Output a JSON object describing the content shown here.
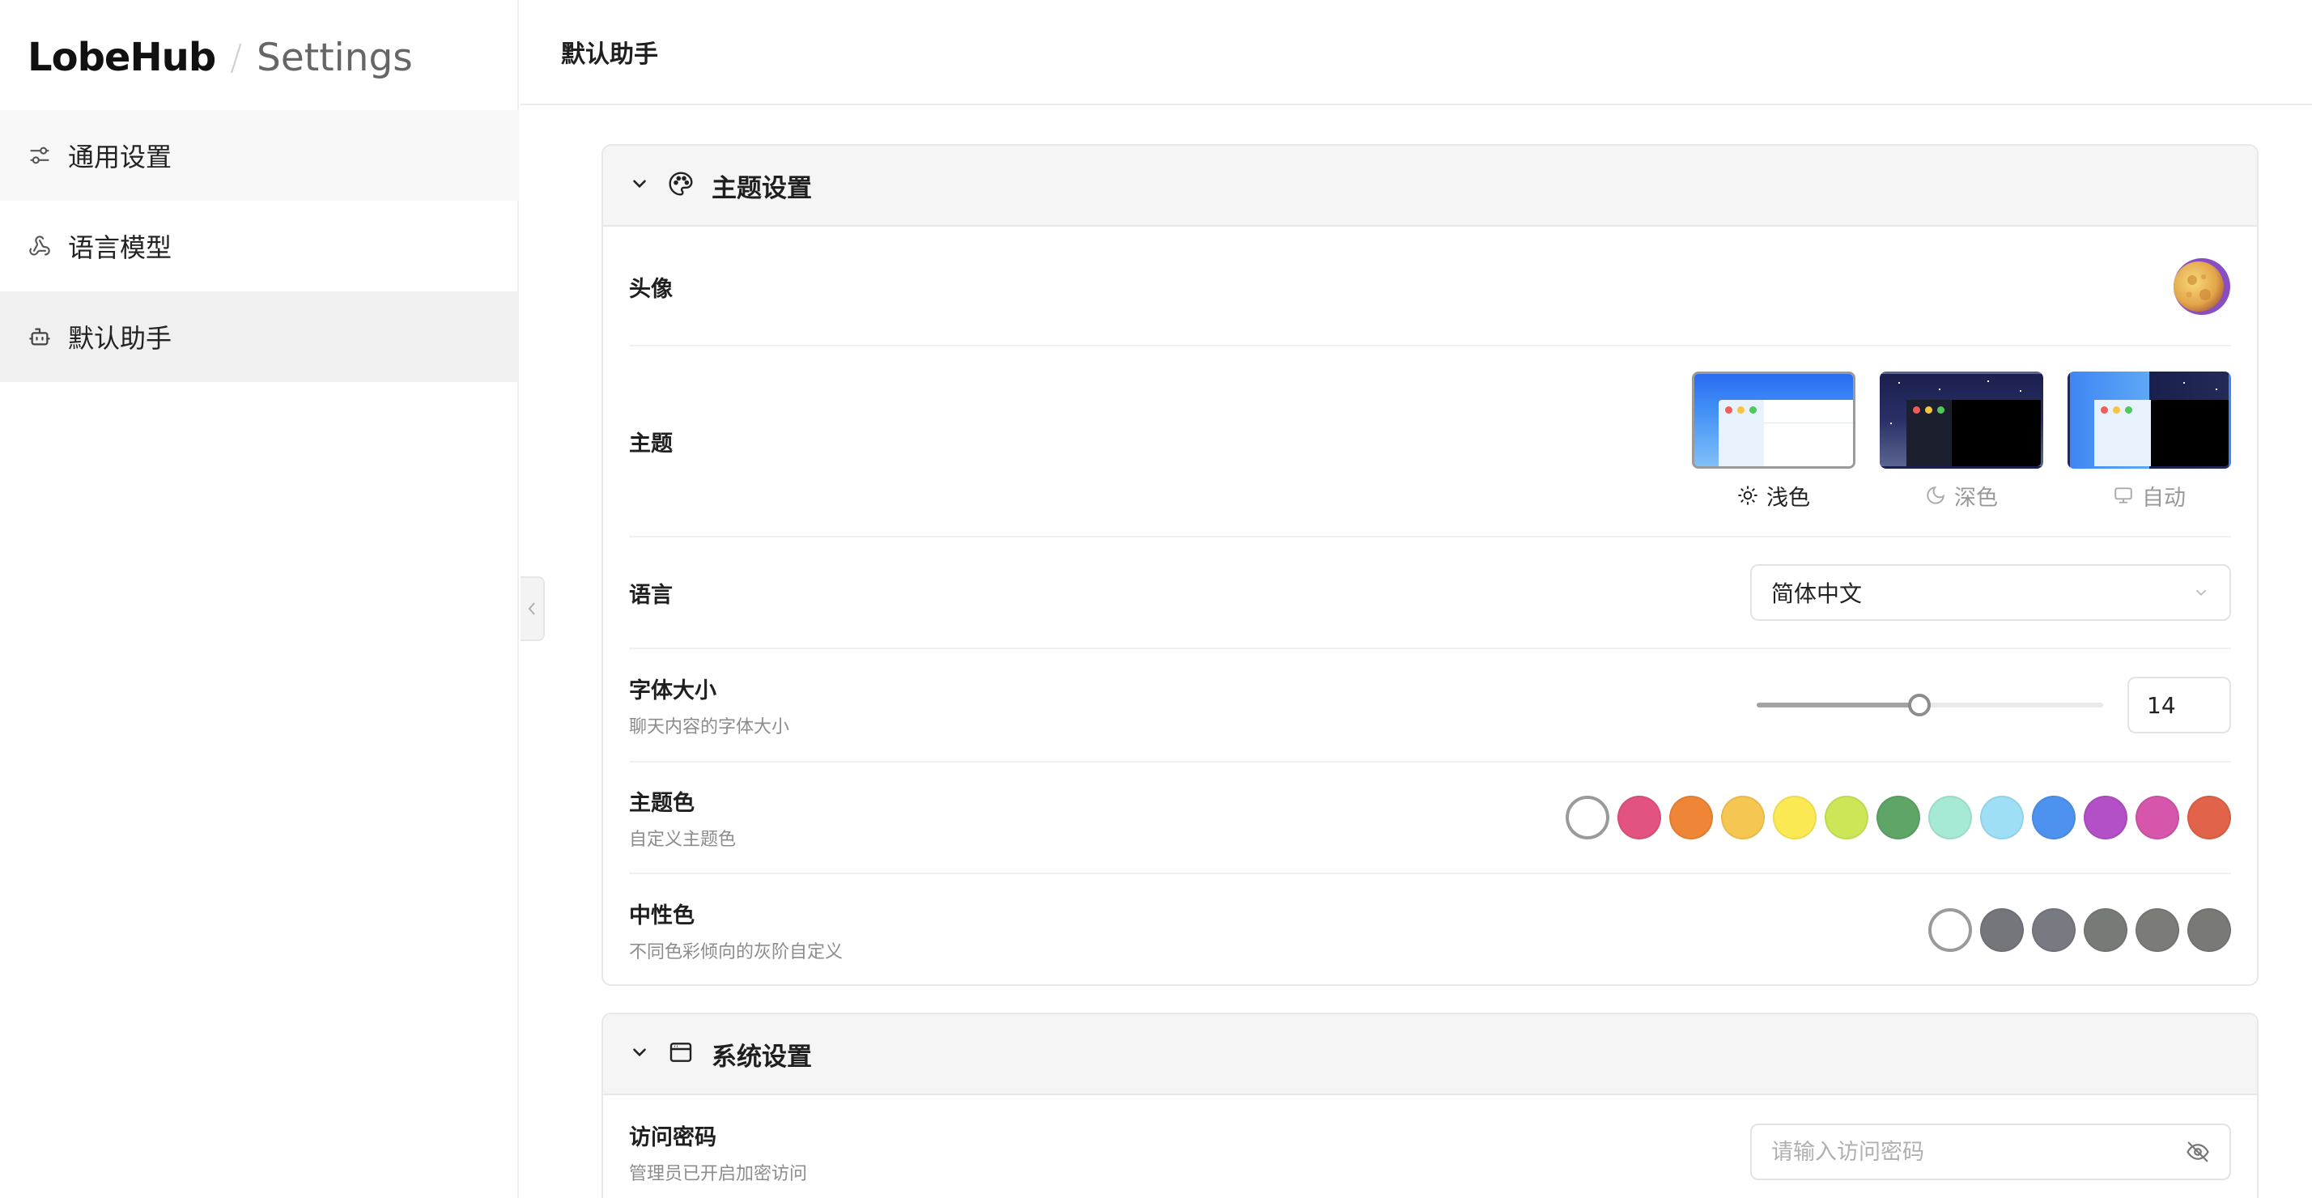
{
  "brand": {
    "logo": "LobeHub",
    "separator": "/",
    "subtitle": "Settings"
  },
  "sidebar": {
    "items": [
      {
        "label": "通用设置",
        "icon": "sliders-icon"
      },
      {
        "label": "语言模型",
        "icon": "webhook-icon"
      },
      {
        "label": "默认助手",
        "icon": "bot-icon"
      }
    ],
    "active_index": 2
  },
  "header": {
    "title": "默认助手"
  },
  "theme_panel": {
    "title": "主题设置",
    "avatar": {
      "label": "头像"
    },
    "theme": {
      "label": "主题",
      "options": [
        {
          "name": "浅色",
          "icon": "sun-icon",
          "selected": true
        },
        {
          "name": "深色",
          "icon": "moon-icon",
          "selected": false
        },
        {
          "name": "自动",
          "icon": "monitor-icon",
          "selected": false
        }
      ]
    },
    "language": {
      "label": "语言",
      "value": "简体中文"
    },
    "font_size": {
      "label": "字体大小",
      "desc": "聊天内容的字体大小",
      "value": "14",
      "slider_fraction": 0.47
    },
    "primary_color": {
      "label": "主题色",
      "desc": "自定义主题色",
      "colors": [
        "#ffffff",
        "#e2537f",
        "#ee8537",
        "#f5c652",
        "#fbe954",
        "#cbe758",
        "#5ea567",
        "#a6e9d4",
        "#9fdff5",
        "#4e92ef",
        "#b34fc7",
        "#d556aa",
        "#e1634a"
      ]
    },
    "neutral_color": {
      "label": "中性色",
      "desc": "不同色彩倾向的灰阶自定义",
      "colors": [
        "#ffffff",
        "#75767c",
        "#777a80",
        "#777b77",
        "#7b7c78",
        "#797a76"
      ]
    }
  },
  "system_panel": {
    "title": "系统设置",
    "password": {
      "label": "访问密码",
      "desc": "管理员已开启加密访问",
      "placeholder": "请输入访问密码"
    }
  }
}
